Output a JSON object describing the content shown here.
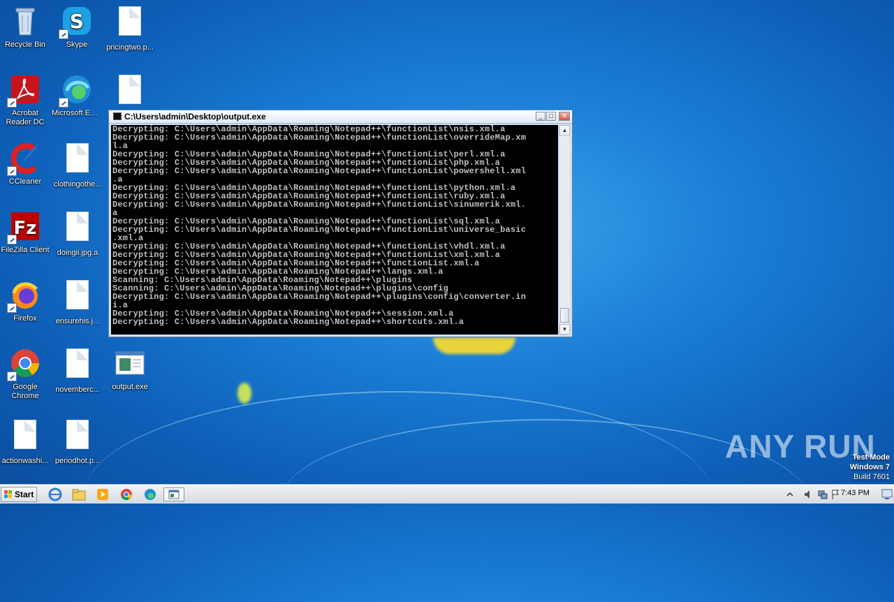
{
  "desktop": {
    "icons": [
      {
        "label": "Recycle Bin"
      },
      {
        "label": "Skype"
      },
      {
        "label": "pricingtwo.p..."
      },
      {
        "label": "Acrobat Reader DC"
      },
      {
        "label": "Microsoft Edge"
      },
      {
        "label": "CCleaner"
      },
      {
        "label": "clothingothe..."
      },
      {
        "label": "FileZilla Client"
      },
      {
        "label": "doingii.jpg.a"
      },
      {
        "label": "Firefox"
      },
      {
        "label": "ensurehis.j..."
      },
      {
        "label": "Google Chrome"
      },
      {
        "label": "novemberc..."
      },
      {
        "label": "output.exe"
      },
      {
        "label": "actionwashi..."
      },
      {
        "label": "periodhot.p..."
      }
    ]
  },
  "console_window": {
    "title": "C:\\Users\\admin\\Desktop\\output.exe",
    "output": "Decrypting: C:\\Users\\admin\\AppData\\Roaming\\Notepad++\\functionList\\nsis.xml.a\nDecrypting: C:\\Users\\admin\\AppData\\Roaming\\Notepad++\\functionList\\overrideMap.xm\nl.a\nDecrypting: C:\\Users\\admin\\AppData\\Roaming\\Notepad++\\functionList\\perl.xml.a\nDecrypting: C:\\Users\\admin\\AppData\\Roaming\\Notepad++\\functionList\\php.xml.a\nDecrypting: C:\\Users\\admin\\AppData\\Roaming\\Notepad++\\functionList\\powershell.xml\n.a\nDecrypting: C:\\Users\\admin\\AppData\\Roaming\\Notepad++\\functionList\\python.xml.a\nDecrypting: C:\\Users\\admin\\AppData\\Roaming\\Notepad++\\functionList\\ruby.xml.a\nDecrypting: C:\\Users\\admin\\AppData\\Roaming\\Notepad++\\functionList\\sinumerik.xml.\na\nDecrypting: C:\\Users\\admin\\AppData\\Roaming\\Notepad++\\functionList\\sql.xml.a\nDecrypting: C:\\Users\\admin\\AppData\\Roaming\\Notepad++\\functionList\\universe_basic\n.xml.a\nDecrypting: C:\\Users\\admin\\AppData\\Roaming\\Notepad++\\functionList\\vhdl.xml.a\nDecrypting: C:\\Users\\admin\\AppData\\Roaming\\Notepad++\\functionList\\xml.xml.a\nDecrypting: C:\\Users\\admin\\AppData\\Roaming\\Notepad++\\functionList.xml.a\nDecrypting: C:\\Users\\admin\\AppData\\Roaming\\Notepad++\\langs.xml.a\nScanning: C:\\Users\\admin\\AppData\\Roaming\\Notepad++\\plugins\nScanning: C:\\Users\\admin\\AppData\\Roaming\\Notepad++\\plugins\\config\nDecrypting: C:\\Users\\admin\\AppData\\Roaming\\Notepad++\\plugins\\config\\converter.in\ni.a\nDecrypting: C:\\Users\\admin\\AppData\\Roaming\\Notepad++\\session.xml.a\nDecrypting: C:\\Users\\admin\\AppData\\Roaming\\Notepad++\\shortcuts.xml.a",
    "minimize_glyph": "_",
    "maximize_glyph": "□",
    "close_glyph": "✕"
  },
  "taskbar": {
    "start_label": "Start",
    "pinned": [
      "ie-icon",
      "explorer-icon",
      "media-player-icon",
      "chrome-icon",
      "edge-icon",
      "console-icon"
    ],
    "clock": "7:43 PM"
  },
  "watermark": {
    "text": "ANY RUN",
    "test_mode": "Test Mode",
    "os": "Windows 7",
    "build": "Build 7601"
  },
  "colors": {
    "console_bg": "#000000",
    "console_fg": "#c0c0c0",
    "desktop_blue": "#1b7fd6"
  }
}
